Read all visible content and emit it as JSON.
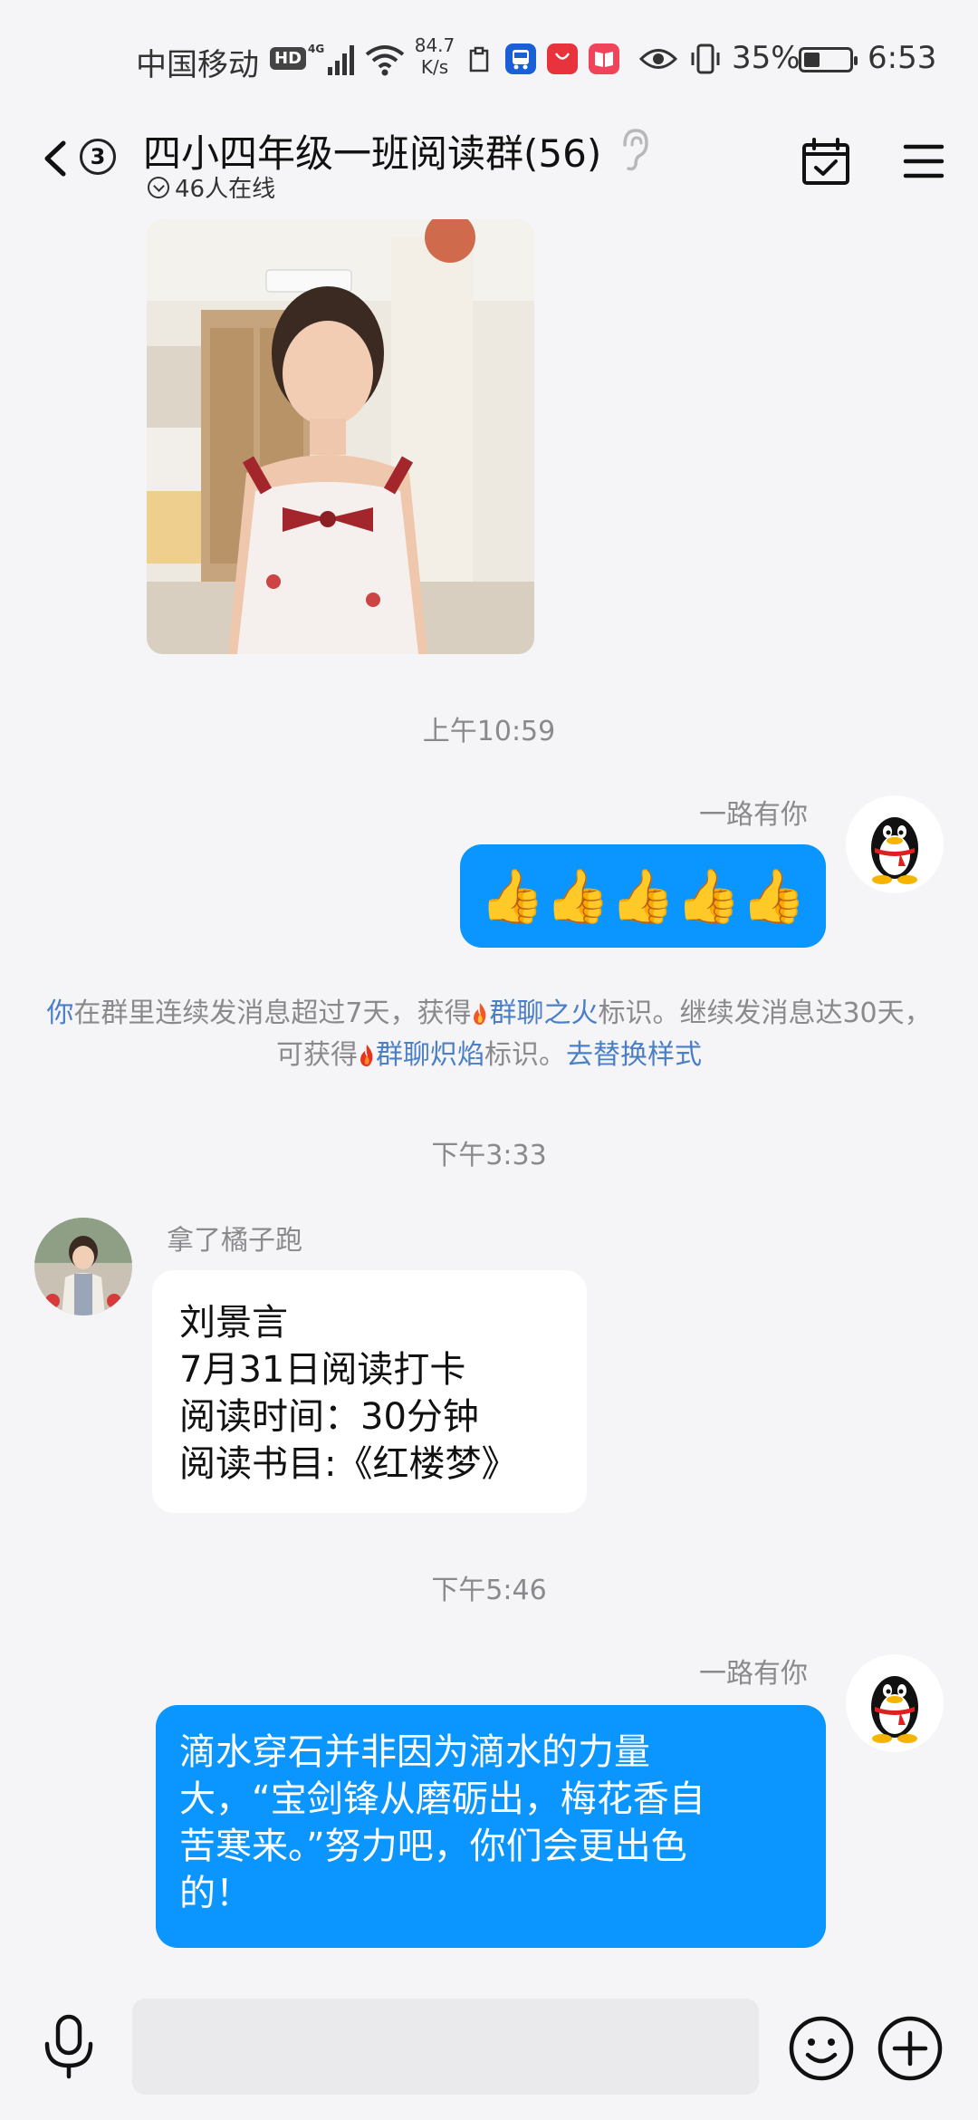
{
  "status_bar": {
    "carrier": "中国移动",
    "hd": "HD",
    "network": "4G",
    "speed_value": "84.7",
    "speed_unit": "K/s",
    "battery": "35%",
    "battery_level": 0.35,
    "time": "6:53"
  },
  "header": {
    "unread_count": "3",
    "title": "四小四年级一班阅读群(56)",
    "online": "46人在线"
  },
  "messages": {
    "ts1": "上午10:59",
    "msg1": {
      "sender": "一路有你",
      "content": "👍👍👍👍👍"
    },
    "notice": {
      "you": "你",
      "p1": "在群里连续发消息超过7天，获得",
      "badge1": "群聊之火",
      "p2": "标识。继续发消息达30天，可获得",
      "badge2": "群聊炽焰",
      "p3": "标识。",
      "action": "去替换样式"
    },
    "ts2": "下午3:33",
    "msg2": {
      "sender": "拿了橘子跑",
      "lines": [
        "刘景言",
        "7月31日阅读打卡",
        "阅读时间：30分钟",
        "阅读书目:《红楼梦》"
      ]
    },
    "ts3": "下午5:46",
    "msg3": {
      "sender": "一路有你",
      "lines": [
        "滴水穿石并非因为滴水的力量",
        "大，“宝剑锋从磨砺出，梅花香自",
        "苦寒来。”努力吧，你们会更出色",
        "的！"
      ]
    }
  },
  "colors": {
    "accent": "#0a95ff",
    "link": "#4a7fc8",
    "background": "#f5f5f7"
  },
  "icons": [
    "back-icon",
    "ear-icon",
    "calendar-check-icon",
    "menu-icon",
    "mic-icon",
    "emoji-icon",
    "plus-icon",
    "fire-icon"
  ]
}
